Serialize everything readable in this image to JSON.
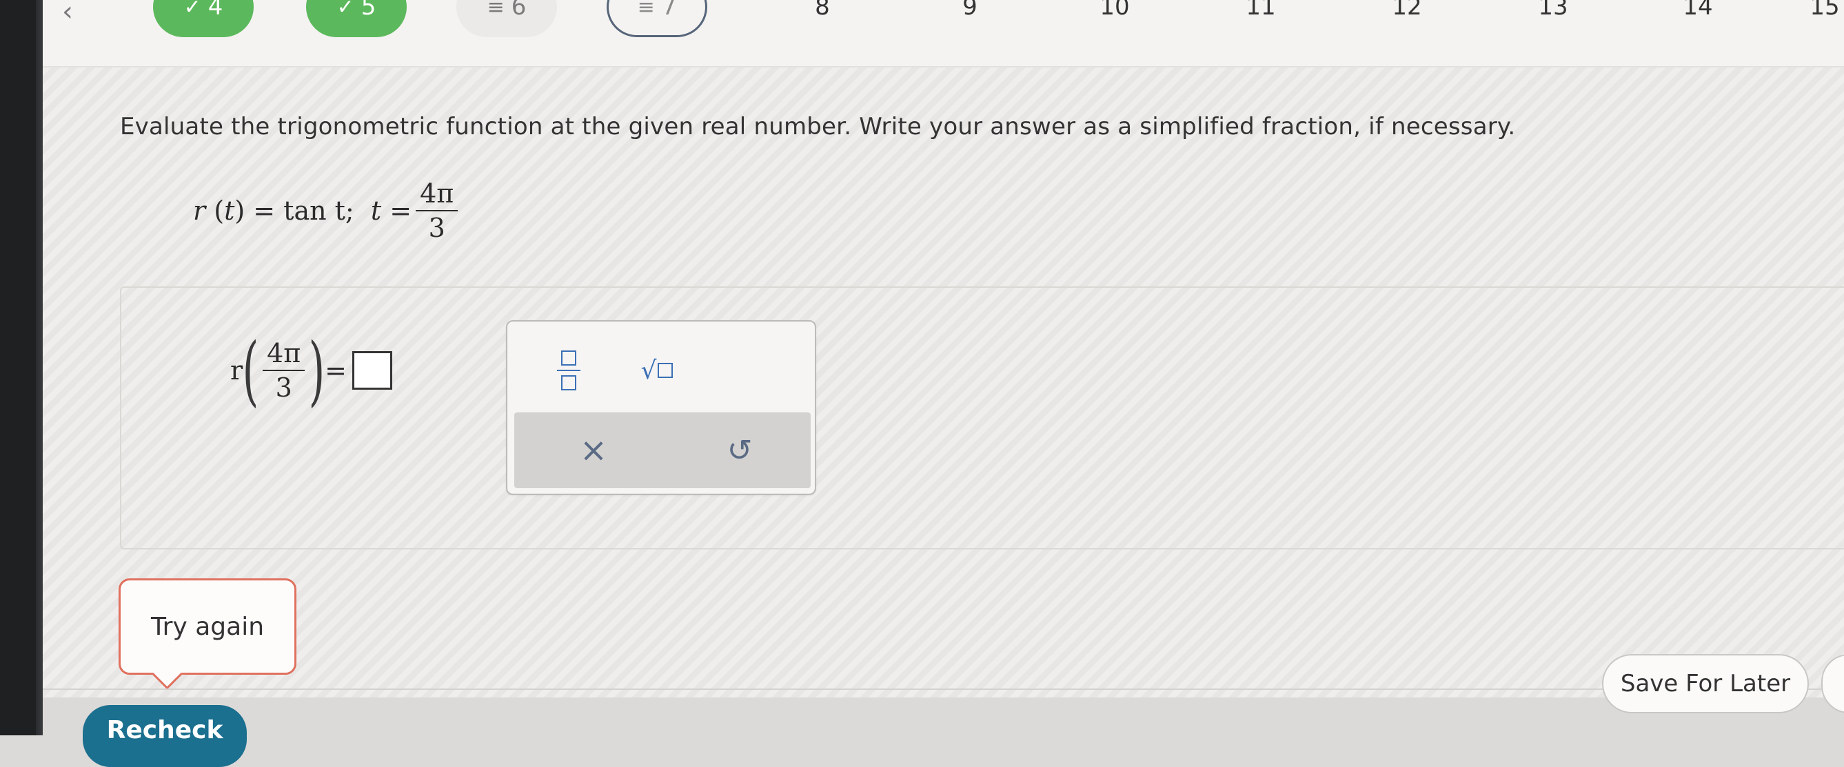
{
  "nav": {
    "prev_icon": "chevron-left-icon",
    "questions": [
      {
        "label": "4",
        "status": "done"
      },
      {
        "label": "5",
        "status": "done"
      },
      {
        "label": "6",
        "status": "pending"
      },
      {
        "label": "7",
        "status": "current"
      },
      {
        "label": "8",
        "status": "unvisited"
      },
      {
        "label": "9",
        "status": "unvisited"
      },
      {
        "label": "10",
        "status": "unvisited"
      },
      {
        "label": "11",
        "status": "unvisited"
      },
      {
        "label": "12",
        "status": "unvisited"
      },
      {
        "label": "13",
        "status": "unvisited"
      },
      {
        "label": "14",
        "status": "unvisited"
      },
      {
        "label": "15",
        "status": "unvisited"
      }
    ],
    "check_mark": "✓",
    "pending_mark": "≡"
  },
  "question": {
    "prompt": "Evaluate the trigonometric function at the given real number. Write your answer as a simplified fraction, if necessary.",
    "func_name": "r",
    "var": "t",
    "rhs": "= tan t;",
    "t_eq": "t =",
    "numerator": "4π",
    "denominator": "3"
  },
  "answer": {
    "func_name": "r",
    "numerator": "4π",
    "denominator": "3",
    "equals": "=",
    "value": ""
  },
  "keypad": {
    "fraction_icon": "fraction-icon",
    "sqrt_icon": "square-root-icon",
    "sqrt_symbol": "√",
    "clear_symbol": "×",
    "undo_symbol": "↺"
  },
  "feedback": {
    "try_again": "Try again"
  },
  "footer": {
    "recheck": "Recheck",
    "save_for_later": "Save For Later"
  },
  "colors": {
    "done": "#5cb85c",
    "current_border": "#56657a",
    "error_border": "#e0705e",
    "primary": "#1b6f8f",
    "keypad_icon": "#3b6fb6"
  }
}
